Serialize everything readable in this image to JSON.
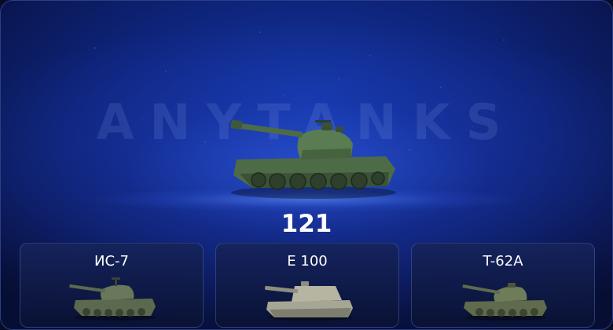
{
  "watermark": "ANYTANKS",
  "featured": {
    "icon": "tank-icon",
    "count": "121"
  },
  "tanks": [
    {
      "name": "ИС-7",
      "icon": "is7-tank-icon"
    },
    {
      "name": "E 100",
      "icon": "e100-tank-icon"
    },
    {
      "name": "T-62A",
      "icon": "t62a-tank-icon"
    }
  ],
  "colors": {
    "background": "#0e2378",
    "glow": "#3a69ff",
    "border": "#2c3f86",
    "tank_green": "#4b6a45",
    "tank_grey": "#9a9b8a"
  }
}
